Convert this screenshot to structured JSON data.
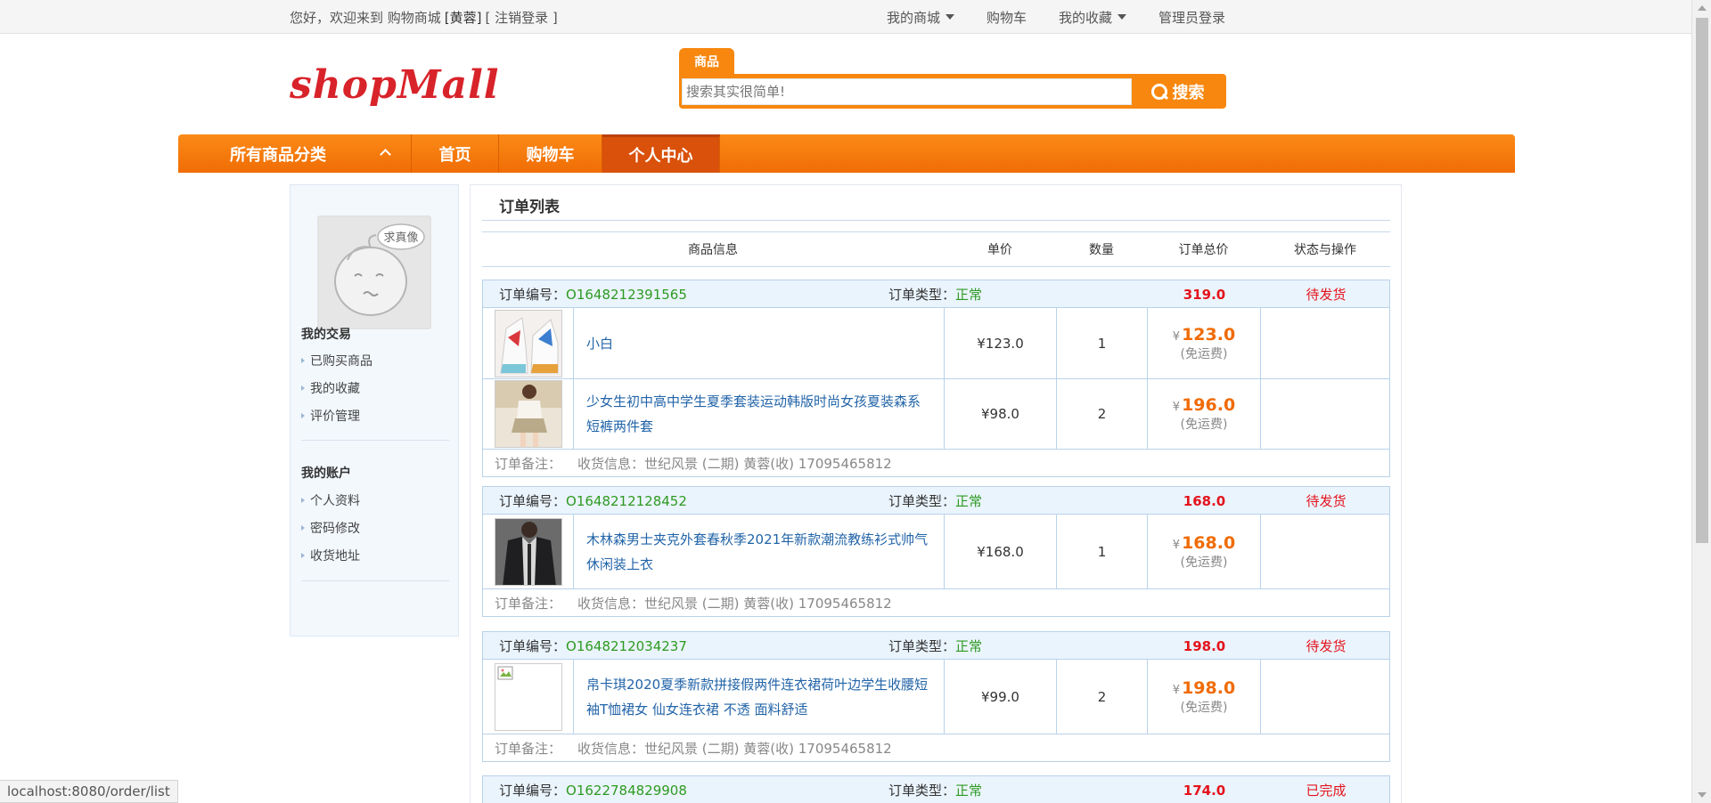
{
  "topbar": {
    "welcome": "您好，欢迎来到 购物商城",
    "username": "[黄蓉]",
    "logout": "[ 注销登录 ]",
    "my_mall": "我的商城",
    "cart": "购物车",
    "favorites": "我的收藏",
    "admin_login": "管理员登录"
  },
  "header": {
    "logo": "shopMall",
    "search_tab": "商品",
    "search_placeholder": "搜索其实很简单!",
    "search_button": "搜索"
  },
  "nav": {
    "categories": "所有商品分类",
    "items": [
      "首页",
      "购物车",
      "个人中心"
    ],
    "active": "个人中心"
  },
  "sidebar": {
    "avatar_badge": "求真像",
    "section1": "我的交易",
    "section1_items": [
      "已购买商品",
      "我的收藏",
      "评价管理"
    ],
    "section2": "我的账户",
    "section2_items": [
      "个人资料",
      "密码修改",
      "收货地址"
    ]
  },
  "main": {
    "title": "订单列表",
    "columns": [
      "商品信息",
      "单价",
      "数量",
      "订单总价",
      "状态与操作"
    ]
  },
  "labels": {
    "order_no": "订单编号：",
    "order_type": "订单类型：",
    "note": "订单备注：",
    "ship_info": "收货信息：",
    "yen": "¥",
    "free_ship": "(免运费)"
  },
  "orders": [
    {
      "no": "O1648212391565",
      "type": "正常",
      "total": "319.0",
      "status": "待发货",
      "address": "世纪风景 (二期) 黄蓉(收) 17095465812",
      "items": [
        {
          "name": "小白",
          "price": "¥123.0",
          "qty": "1",
          "subtotal": "123.0",
          "img": "shoes"
        },
        {
          "name": "少女生初中高中学生夏季套装运动韩版时尚女孩夏装森系短裤两件套",
          "price": "¥98.0",
          "qty": "2",
          "subtotal": "196.0",
          "img": "girl"
        }
      ]
    },
    {
      "no": "O1648212128452",
      "type": "正常",
      "total": "168.0",
      "status": "待发货",
      "address": "世纪风景 (二期) 黄蓉(收) 17095465812",
      "items": [
        {
          "name": "木林森男士夹克外套春秋季2021年新款潮流教练衫式帅气休闲装上衣",
          "price": "¥168.0",
          "qty": "1",
          "subtotal": "168.0",
          "img": "jacket"
        }
      ]
    },
    {
      "no": "O1648212034237",
      "type": "正常",
      "total": "198.0",
      "status": "待发货",
      "address": "世纪风景 (二期) 黄蓉(收) 17095465812",
      "items": [
        {
          "name": "帛卡琪2020夏季新款拼接假两件连衣裙荷叶边学生收腰短袖T恤裙女 仙女连衣裙 不透 面料舒适",
          "price": "¥99.0",
          "qty": "2",
          "subtotal": "198.0",
          "img": "broken"
        }
      ]
    },
    {
      "no": "O1622784829908",
      "type": "正常",
      "total": "174.0",
      "status": "已完成",
      "address": "",
      "items": []
    }
  ],
  "statusbar": "localhost:8080/order/list",
  "colors": {
    "accent": "#f7870f",
    "link": "#2264a8",
    "price": "#f06b05",
    "alert": "#e4131c",
    "ok": "#2e9a21"
  }
}
